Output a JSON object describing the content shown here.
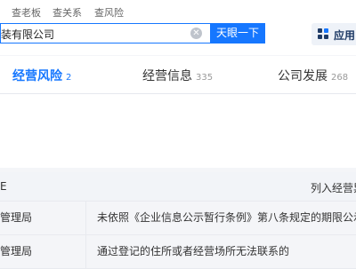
{
  "search_tabs": [
    "查老板",
    "查关系",
    "查风险"
  ],
  "search": {
    "value": "装有限公司",
    "clear_icon": "clear-icon",
    "button_label": "天眼一下"
  },
  "app_button": {
    "label": "应用",
    "icon": "grid-icon"
  },
  "tabs": [
    {
      "label": "经营风险",
      "count": "2"
    },
    {
      "label": "经营信息",
      "count": "335"
    },
    {
      "label": "公司发展",
      "count": "268"
    }
  ],
  "table": {
    "header": {
      "col_a": "E",
      "col_b": "列入经营异"
    },
    "rows": [
      {
        "col_a": "管理局",
        "col_b": "未依照《企业信息公示暂行条例》第八条规定的期限公示"
      },
      {
        "col_a": "管理局",
        "col_b": "通过登记的住所或者经营场所无法联系的"
      }
    ]
  },
  "colors": {
    "accent": "#1677ff"
  }
}
